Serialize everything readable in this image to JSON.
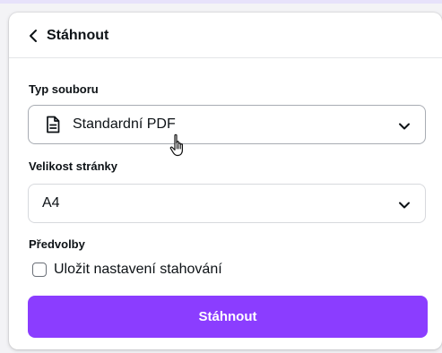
{
  "header": {
    "back_icon": "chevron-left-icon",
    "title": "Stáhnout"
  },
  "file_type": {
    "label": "Typ souboru",
    "icon": "file-text-icon",
    "value": "Standardní PDF",
    "chevron": "chevron-down-icon"
  },
  "page_size": {
    "label": "Velikost stránky",
    "value": "A4",
    "chevron": "chevron-down-icon"
  },
  "presets": {
    "label": "Předvolby",
    "checkbox_label": "Uložit nastavení stahování",
    "checked": false
  },
  "download_button": {
    "label": "Stáhnout"
  },
  "colors": {
    "accent": "#8b3dff",
    "text": "#0d1216",
    "border": "#d7d9dd"
  }
}
